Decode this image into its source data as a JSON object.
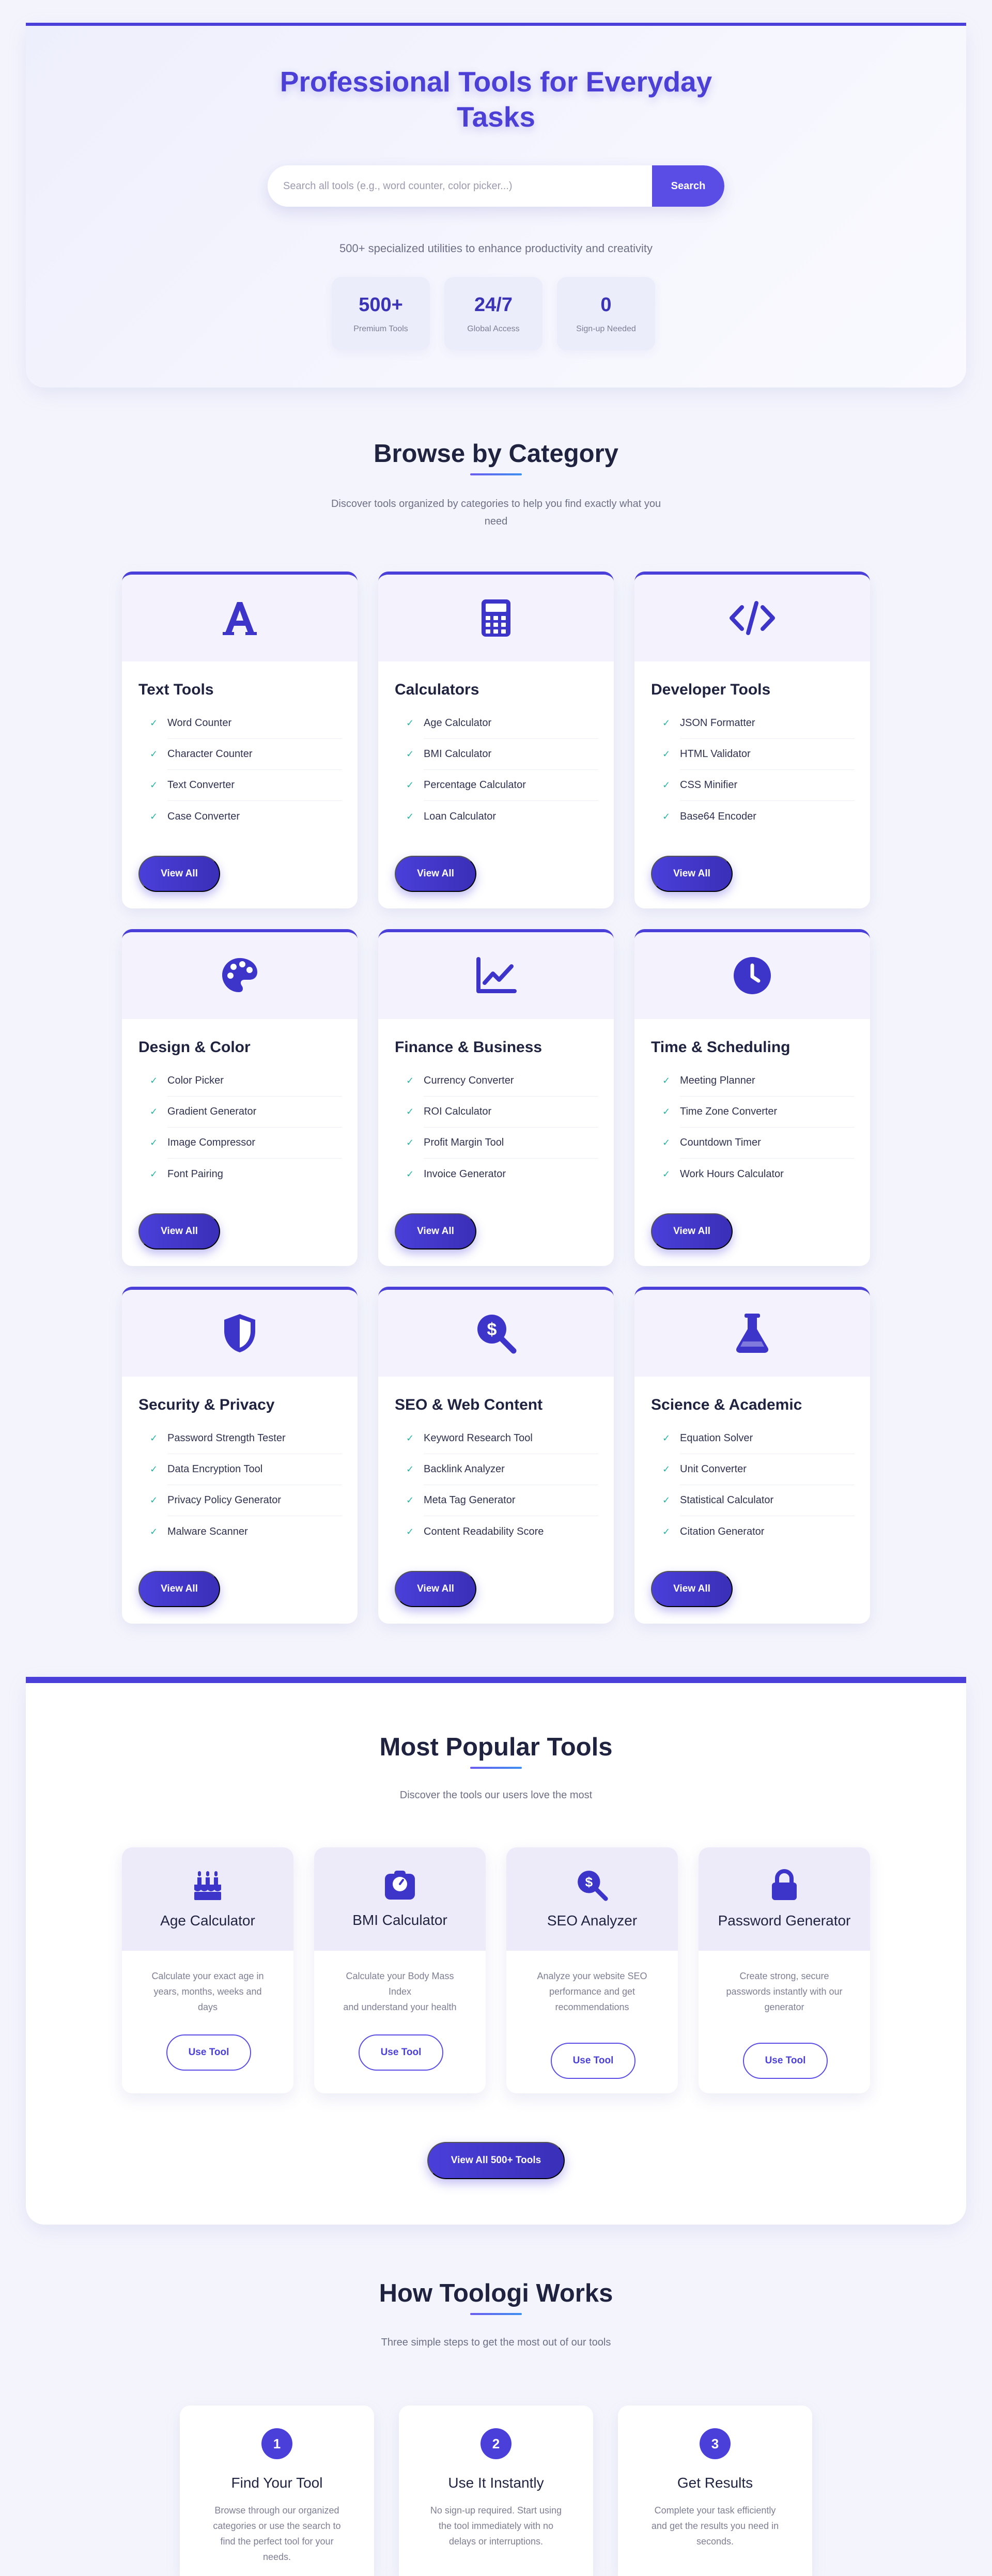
{
  "hero": {
    "title_line1": "Professional Tools for Everyday",
    "title_line2": "Tasks",
    "search_placeholder": "Search all tools (e.g., word counter, color picker...)",
    "search_button": "Search",
    "subtitle": "500+ specialized utilities to enhance productivity and creativity",
    "stats": [
      {
        "value": "500+",
        "label": "Premium Tools"
      },
      {
        "value": "24/7",
        "label": "Global Access"
      },
      {
        "value": "0",
        "label": "Sign-up Needed"
      }
    ]
  },
  "browse": {
    "title": "Browse by Category",
    "subtitle_line1": "Discover tools organized by categories to help you find exactly what you",
    "subtitle_line2": "need",
    "view_all_label": "View All",
    "categories": [
      {
        "title": "Text Tools",
        "icon": "letter-a-icon",
        "items": [
          "Word Counter",
          "Character Counter",
          "Text Converter",
          "Case Converter"
        ]
      },
      {
        "title": "Calculators",
        "icon": "calculator-icon",
        "items": [
          "Age Calculator",
          "BMI Calculator",
          "Percentage Calculator",
          "Loan Calculator"
        ]
      },
      {
        "title": "Developer Tools",
        "icon": "code-icon",
        "items": [
          "JSON Formatter",
          "HTML Validator",
          "CSS Minifier",
          "Base64 Encoder"
        ]
      },
      {
        "title": "Design & Color",
        "icon": "palette-icon",
        "items": [
          "Color Picker",
          "Gradient Generator",
          "Image Compressor",
          "Font Pairing"
        ]
      },
      {
        "title": "Finance & Business",
        "icon": "chart-line-icon",
        "items": [
          "Currency Converter",
          "ROI Calculator",
          "Profit Margin Tool",
          "Invoice Generator"
        ]
      },
      {
        "title": "Time & Scheduling",
        "icon": "clock-icon",
        "items": [
          "Meeting Planner",
          "Time Zone Converter",
          "Countdown Timer",
          "Work Hours Calculator"
        ]
      },
      {
        "title": "Security & Privacy",
        "icon": "shield-icon",
        "items": [
          "Password Strength Tester",
          "Data Encryption Tool",
          "Privacy Policy Generator",
          "Malware Scanner"
        ]
      },
      {
        "title": "SEO & Web Content",
        "icon": "search-dollar-icon",
        "items": [
          "Keyword Research Tool",
          "Backlink Analyzer",
          "Meta Tag Generator",
          "Content Readability Score"
        ]
      },
      {
        "title": "Science & Academic",
        "icon": "flask-icon",
        "items": [
          "Equation Solver",
          "Unit Converter",
          "Statistical Calculator",
          "Citation Generator"
        ]
      }
    ]
  },
  "popular": {
    "title": "Most Popular Tools",
    "subtitle": "Discover the tools our users love the most",
    "use_label": "Use Tool",
    "tools": [
      {
        "title": "Age Calculator",
        "icon": "birthday-cake-icon",
        "desc_lines": [
          "Calculate your exact age in",
          "years, months, weeks and days"
        ]
      },
      {
        "title": "BMI Calculator",
        "icon": "weight-scale-icon",
        "desc_lines": [
          "Calculate your Body Mass Index",
          "and understand your health"
        ]
      },
      {
        "title": "SEO Analyzer",
        "icon": "search-dollar-icon",
        "desc_lines": [
          "Analyze your website SEO",
          "performance and get",
          "recommendations"
        ]
      },
      {
        "title": "Password Generator",
        "icon": "lock-icon",
        "desc_lines": [
          "Create strong, secure",
          "passwords instantly with our",
          "generator"
        ]
      }
    ],
    "view_all_button": "View All 500+ Tools"
  },
  "how": {
    "title": "How Toologi Works",
    "subtitle": "Three simple steps to get the most out of our tools",
    "steps": [
      {
        "num": "1",
        "title": "Find Your Tool",
        "desc_lines": [
          "Browse through our organized",
          "categories or use the search to",
          "find the perfect tool for your",
          "needs."
        ]
      },
      {
        "num": "2",
        "title": "Use It Instantly",
        "desc_lines": [
          "No sign-up required. Start using",
          "the tool immediately with no",
          "delays or interruptions."
        ]
      },
      {
        "num": "3",
        "title": "Get Results",
        "desc_lines": [
          "Complete your task efficiently",
          "and get the results you need in",
          "seconds."
        ]
      }
    ]
  },
  "colors": {
    "accent": "#4a3fd9",
    "check": "#24b59f",
    "background": "#f4f5fc"
  }
}
